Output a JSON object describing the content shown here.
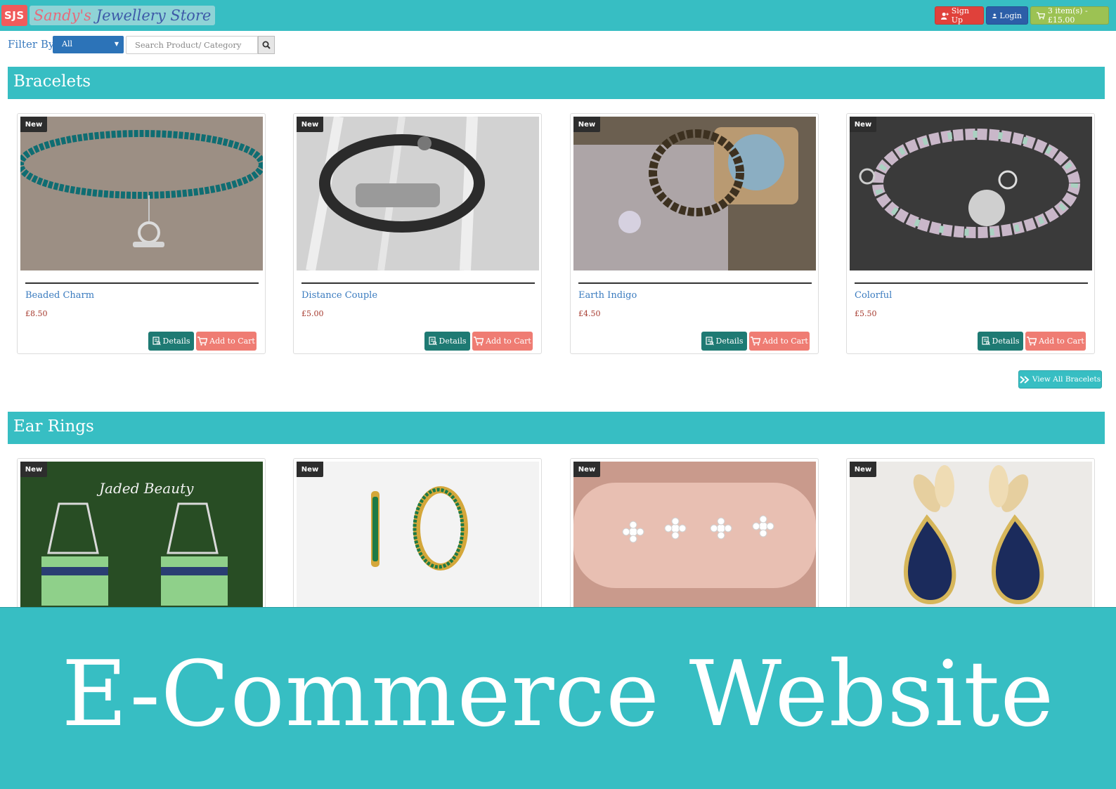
{
  "header": {
    "logo_badge": "SJS",
    "logo_text_part1": "Sandy's",
    "logo_text_part2": "Jewellery Store",
    "signup_label": "Sign Up",
    "login_label": "Login",
    "cart_label": "3 item(s) - £15.00"
  },
  "filter": {
    "label": "Filter By:",
    "selected": "All",
    "search_placeholder": "Search Product/ Category"
  },
  "sections": [
    {
      "title": "Bracelets",
      "products": [
        {
          "badge": "New",
          "name": "Beaded Charm",
          "price": "£8.50",
          "details_label": "Details",
          "cart_label": "Add to Cart"
        },
        {
          "badge": "New",
          "name": "Distance Couple",
          "price": "£5.00",
          "details_label": "Details",
          "cart_label": "Add to Cart"
        },
        {
          "badge": "New",
          "name": "Earth Indigo",
          "price": "£4.50",
          "details_label": "Details",
          "cart_label": "Add to Cart"
        },
        {
          "badge": "New",
          "name": "Colorful",
          "price": "£5.50",
          "details_label": "Details",
          "cart_label": "Add to Cart"
        }
      ],
      "view_all_label": "View All Bracelets"
    },
    {
      "title": "Ear Rings",
      "products": [
        {
          "badge": "New",
          "image_caption": "Jaded Beauty"
        },
        {
          "badge": "New"
        },
        {
          "badge": "New"
        },
        {
          "badge": "New"
        }
      ]
    }
  ],
  "banner": {
    "title": "E-Commerce Website"
  },
  "colors": {
    "teal": "#37bec3",
    "signup_red": "#e0413b",
    "login_blue": "#2c5ea8",
    "cart_green": "#9cc253",
    "details_green": "#1e7a73",
    "add_to_cart_salmon": "#ef7c73",
    "link_blue": "#3a7bbf",
    "price_red": "#a63a2e"
  },
  "icons": [
    "user-plus-icon",
    "user-icon",
    "cart-icon",
    "search-icon",
    "details-icon",
    "add-cart-icon",
    "double-chevron-right-icon"
  ]
}
